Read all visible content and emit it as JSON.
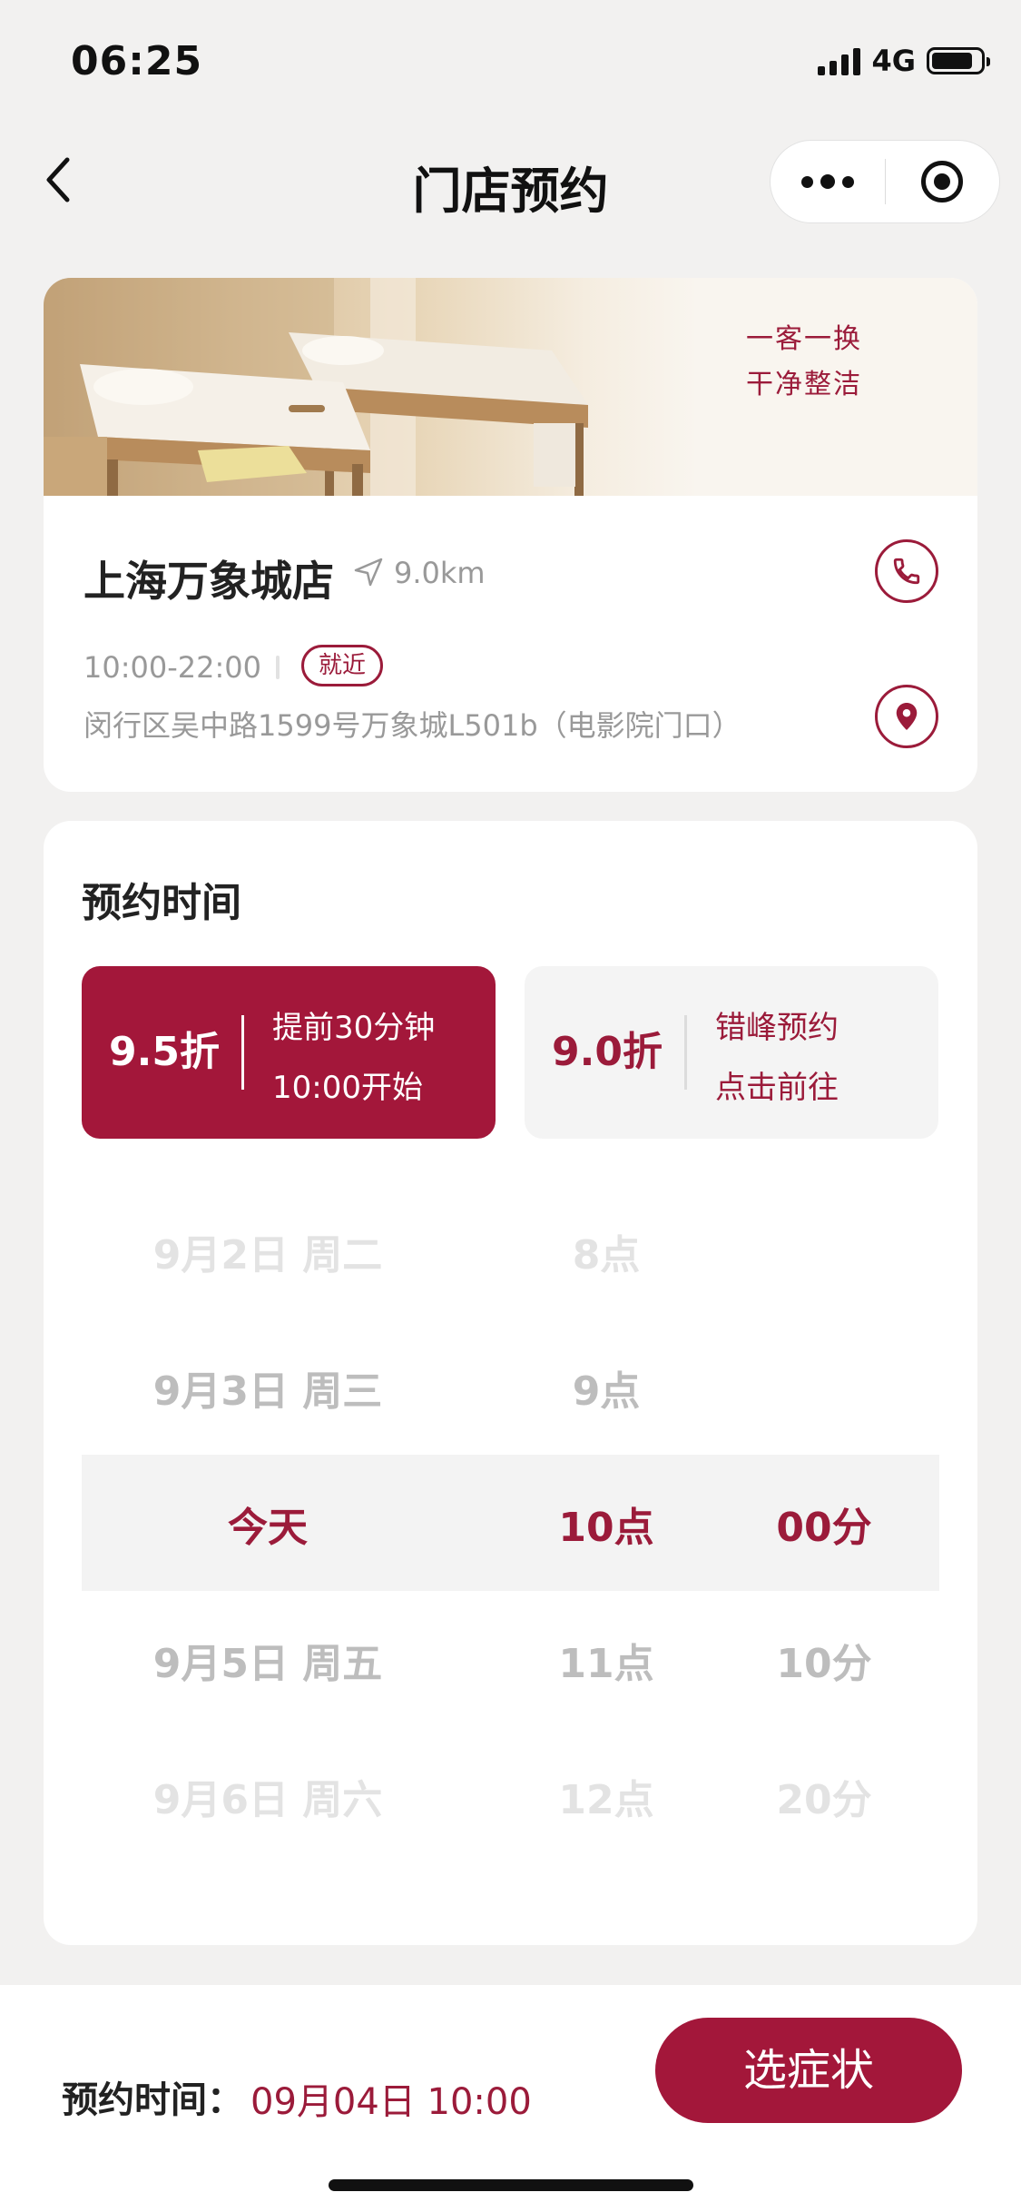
{
  "status_bar": {
    "time": "06:25",
    "network": "4G"
  },
  "nav": {
    "title": "门店预约",
    "more_icon": "more-dots-icon",
    "close_icon": "target-icon",
    "back_icon": "chevron-left-icon"
  },
  "store": {
    "banner_line1": "一客一换",
    "banner_line2": "干净整洁",
    "name": "上海万象城店",
    "distance": "9.0km",
    "hours": "10:00-22:00",
    "tag": "就近",
    "address": "闵行区吴中路1599号万象城L501b（电影院门口）"
  },
  "booking": {
    "title": "预约时间",
    "offers": [
      {
        "discount": "9.5折",
        "line1": "提前30分钟",
        "line2": "10:00开始",
        "selected": true
      },
      {
        "discount": "9.0折",
        "line1": "错峰预约",
        "line2": "点击前往",
        "selected": false
      }
    ],
    "picker": {
      "dates": [
        "9月2日 周二",
        "9月3日 周三",
        "今天",
        "9月5日 周五",
        "9月6日 周六"
      ],
      "hours": [
        "8点",
        "9点",
        "10点",
        "11点",
        "12点"
      ],
      "minutes": [
        "00分",
        "10分",
        "20分"
      ],
      "selected": {
        "date": "今天",
        "hour": "10点",
        "minute": "00分"
      }
    }
  },
  "footer": {
    "label": "预约时间：",
    "value": "09月04日 10:00",
    "button": "选症状"
  },
  "colors": {
    "accent": "#a3173a",
    "background": "#f2f1f0"
  }
}
